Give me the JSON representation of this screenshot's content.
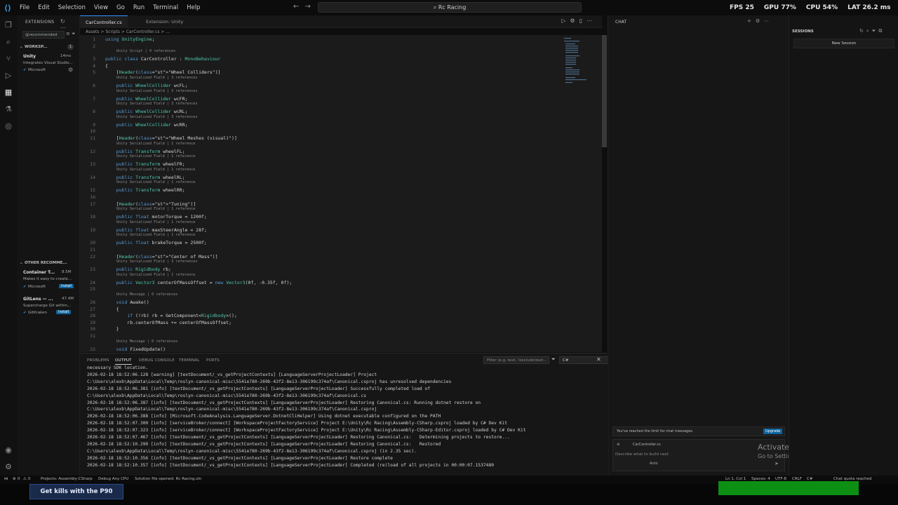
{
  "titlebar": {
    "menu": [
      "File",
      "Edit",
      "Selection",
      "View",
      "Go",
      "Run",
      "Terminal",
      "Help"
    ],
    "search": "Rc Racing",
    "stats": {
      "fps_label": "FPS",
      "fps": "25",
      "gpu_label": "GPU",
      "gpu": "77%",
      "cpu_label": "CPU",
      "cpu": "54%",
      "lat_label": "LAT",
      "lat": "26.2 ms"
    }
  },
  "sidebar": {
    "title": "EXTENSIONS",
    "search_placeholder": "@recommended",
    "workspace_label": "WORKSP...",
    "workspace_count": "1",
    "workspace_ext": {
      "name": "Unity",
      "time": "14ms",
      "desc": "Integrates Visual Studio...",
      "publisher": "Microsoft"
    },
    "other_label": "OTHER RECOMME...",
    "other": [
      {
        "name": "Container T...",
        "count": "8.5M",
        "desc": "Makes it easy to create...",
        "publisher": "Microsoft",
        "action": "Install"
      },
      {
        "name": "GitLens — ...",
        "count": "47.4M",
        "desc": "Supercharge Git within...",
        "publisher": "GitKraken",
        "action": "Install"
      }
    ]
  },
  "editor": {
    "tabs": [
      {
        "label": "CarController.cs"
      },
      {
        "label": "Extension: Unity"
      }
    ],
    "breadcrumb": "Assets > Scripts > CarController.cs > ...",
    "lines": [
      {
        "n": "1",
        "t": "using UnityEngine;"
      },
      {
        "n": "2",
        "t": ""
      },
      {
        "lens": "Unity Script | 0 references"
      },
      {
        "n": "3",
        "t": "public class CarController : MonoBehaviour"
      },
      {
        "n": "4",
        "t": "{"
      },
      {
        "n": "5",
        "t": "    [Header(\"Wheel Colliders\")]"
      },
      {
        "lens": "Unity Serialized Field | 3 references"
      },
      {
        "n": "6",
        "t": "    public WheelCollider wcFL;"
      },
      {
        "lens": "Unity Serialized Field | 3 references"
      },
      {
        "n": "7",
        "t": "    public WheelCollider wcFR;"
      },
      {
        "lens": "Unity Serialized Field | 3 references"
      },
      {
        "n": "8",
        "t": "    public WheelCollider wcRL;"
      },
      {
        "lens": "Unity Serialized Field | 3 references"
      },
      {
        "n": "9",
        "t": "    public WheelCollider wcRR;"
      },
      {
        "n": "10",
        "t": ""
      },
      {
        "n": "11",
        "t": "    [Header(\"Wheel Meshes (visual)\")]"
      },
      {
        "lens": "Unity Serialized Field | 1 reference"
      },
      {
        "n": "12",
        "t": "    public Transform wheelFL;"
      },
      {
        "lens": "Unity Serialized Field | 1 reference"
      },
      {
        "n": "13",
        "t": "    public Transform wheelFR;"
      },
      {
        "lens": "Unity Serialized Field | 1 reference"
      },
      {
        "n": "14",
        "t": "    public Transform wheelRL;"
      },
      {
        "lens": "Unity Serialized Field | 1 reference"
      },
      {
        "n": "15",
        "t": "    public Transform wheelRR;"
      },
      {
        "n": "16",
        "t": ""
      },
      {
        "n": "17",
        "t": "    [Header(\"Tuning\")]"
      },
      {
        "lens": "Unity Serialized Field | 1 reference"
      },
      {
        "n": "18",
        "t": "    public float motorTorque = 1200f;"
      },
      {
        "lens": "Unity Serialized Field | 1 reference"
      },
      {
        "n": "19",
        "t": "    public float maxSteerAngle = 28f;"
      },
      {
        "lens": "Unity Serialized Field | 1 reference"
      },
      {
        "n": "20",
        "t": "    public float brakeTorque = 2500f;"
      },
      {
        "n": "21",
        "t": ""
      },
      {
        "n": "22",
        "t": "    [Header(\"Center of Mass\")]"
      },
      {
        "lens": "Unity Serialized Field | 3 references"
      },
      {
        "n": "23",
        "t": "    public Rigidbody rb;"
      },
      {
        "lens": "Unity Serialized Field | 1 reference"
      },
      {
        "n": "24",
        "t": "    public Vector3 centerOfMassOffset = new Vector3(0f, -0.35f, 0f);"
      },
      {
        "n": "25",
        "t": ""
      },
      {
        "lens": "Unity Message | 0 references"
      },
      {
        "n": "26",
        "t": "    void Awake()"
      },
      {
        "n": "27",
        "t": "    {"
      },
      {
        "n": "28",
        "t": "        if (!rb) rb = GetComponent<Rigidbody>();"
      },
      {
        "n": "29",
        "t": "        rb.centerOfMass += centerOfMassOffset;"
      },
      {
        "n": "30",
        "t": "    }"
      },
      {
        "n": "31",
        "t": ""
      },
      {
        "lens": "Unity Message | 0 references"
      },
      {
        "n": "32",
        "t": "    void FixedUpdate()"
      }
    ]
  },
  "panel": {
    "tabs": [
      "PROBLEMS",
      "OUTPUT",
      "DEBUG CONSOLE",
      "TERMINAL",
      "PORTS"
    ],
    "active_tab": "OUTPUT",
    "filter_placeholder": "Filter (e.g. text, !exclude\\text...",
    "channel": "C#",
    "output": [
      "necessary SDK location.",
      "2026-02-18 18:52:06.128 [warning] [textDocument/_vs_getProjectContexts] [LanguageServerProjectLoader] Project",
      "C:\\Users\\alexb\\AppData\\Local\\Temp\\roslyn-canonical-misc\\5541e780-269b-43f2-8e13-306199c374af\\Canonical.csproj has unresolved dependencies",
      "2026-02-18 18:52:06.381 [info] [textDocument/_vs_getProjectContexts] [LanguageServerProjectLoader] Successfully completed load of",
      "C:\\Users\\alexb\\AppData\\Local\\Temp\\roslyn-canonical-misc\\5541e780-269b-43f2-8e13-306199c374af\\Canonical.cs",
      "2026-02-18 18:52:06.387 [info] [textDocument/_vs_getProjectContexts] [LanguageServerProjectLoader] Restoring Canonical.cs: Running dotnet restore on",
      "C:\\Users\\alexb\\AppData\\Local\\Temp\\roslyn-canonical-misc\\5541e780-269b-43f2-8e13-306199c374af\\Canonical.csproj",
      "2026-02-18 18:52:06.388 [info] [Microsoft.CodeAnalysis.LanguageServer.DotnetCliHelper] Using dotnet executable configured on the PATH",
      "2026-02-18 18:52:07.300 [info] [serviceBroker/connect] [WorkspaceProjectFactoryService] Project E:\\Unity\\Rc Racing\\Assembly-CSharp.csproj loaded by C# Dev Kit",
      "2026-02-18 18:52:07.323 [info] [serviceBroker/connect] [WorkspaceProjectFactoryService] Project E:\\Unity\\Rc Racing\\Assembly-CSharp-Editor.csproj loaded by C# Dev Kit",
      "2026-02-18 18:52:07.467 [info] [textDocument/_vs_getProjectContexts] [LanguageServerProjectLoader] Restoring Canonical.cs:   Determining projects to restore...",
      "2026-02-18 18:52:10.290 [info] [textDocument/_vs_getProjectContexts] [LanguageServerProjectLoader] Restoring Canonical.cs:   Restored",
      "C:\\Users\\alexb\\AppData\\Local\\Temp\\roslyn-canonical-misc\\5541e780-269b-43f2-8e13-306199c374af\\Canonical.csproj (in 2.35 sec).",
      "2026-02-18 18:52:10.356 [info] [textDocument/_vs_getProjectContexts] [LanguageServerProjectLoader] Restore complete",
      "2026-02-18 18:52:10.357 [info] [textDocument/_vs_getProjectContexts] [LanguageServerProjectLoader] Completed (re)load of all projects in 00:00:07.1537480"
    ]
  },
  "chat": {
    "title": "CHAT",
    "limit_msg": "You've reached the limit for chat messages.",
    "upgrade": "Upgrade",
    "context_file": "CarController.cs",
    "input_placeholder": "Describe what to build next",
    "mode": "Auto",
    "watermark_title": "Activate Windows",
    "watermark_sub": "Go to Settings to activate Windows."
  },
  "sessions": {
    "title": "SESSIONS",
    "new_session": "New Session"
  },
  "statusbar": {
    "errors": "0",
    "warnings": "0",
    "project": "Projects: Assembly-CSharp",
    "debug": "Debug Any CPU",
    "solution": "Solution file opened: Rc Racing.sln",
    "position": "Ln 1, Col 1",
    "spaces": "Spaces: 4",
    "encoding": "UTF-8",
    "eol": "CRLF",
    "language": "C#",
    "quota": "Chat quota reached"
  },
  "taskbar": {
    "ad_text": "Get kills with the P90"
  },
  "colors": {
    "accent": "#3794ff",
    "badge": "#0e639c",
    "keyword": "#569cd6",
    "type": "#4ec9b0",
    "string": "#ce9178"
  }
}
